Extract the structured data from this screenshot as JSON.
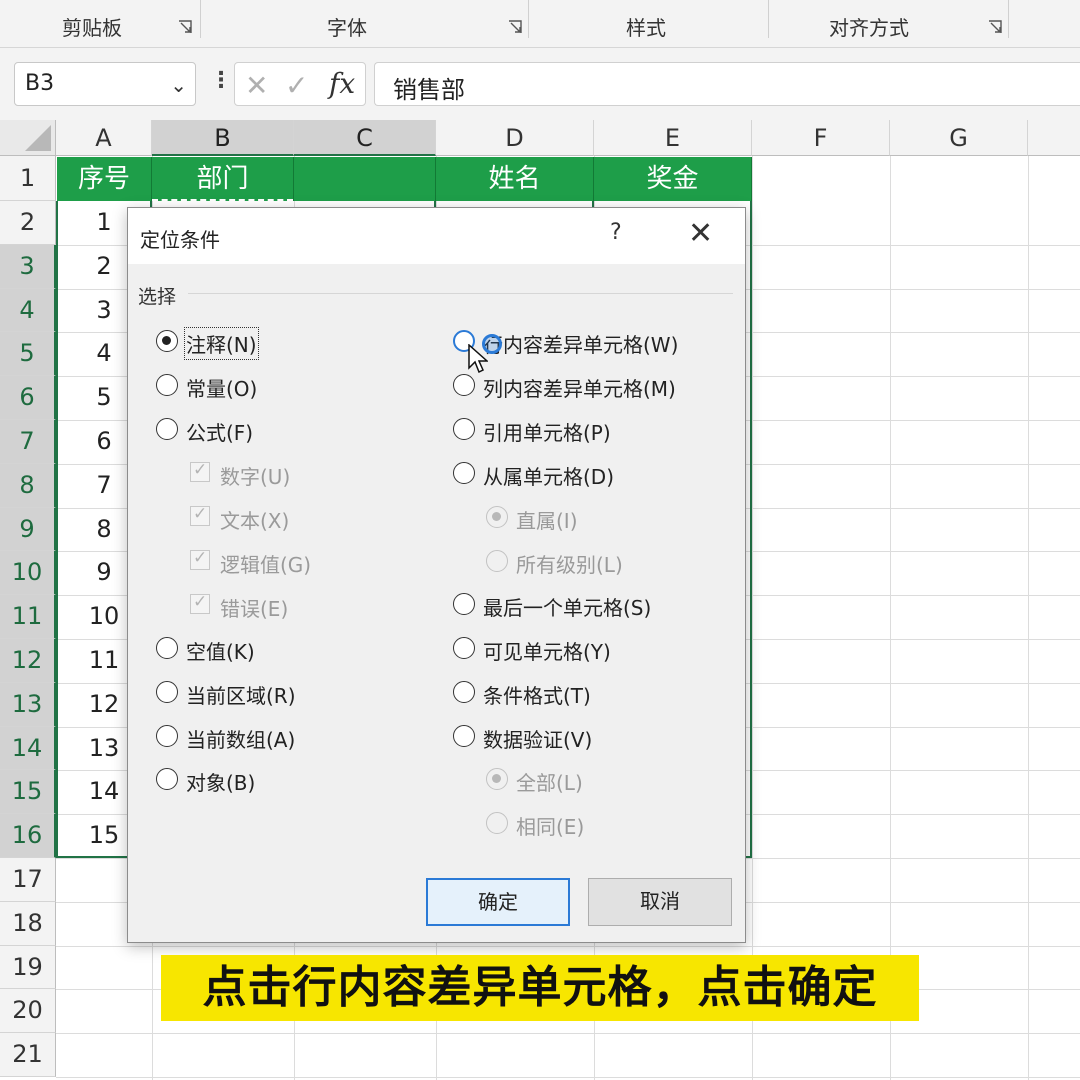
{
  "ribbon": {
    "groups": [
      "剪贴板",
      "字体",
      "样式",
      "对齐方式"
    ]
  },
  "formula_bar": {
    "name_box": "B3",
    "fx_label": "fx",
    "value": "销售部"
  },
  "sheet": {
    "columns": [
      "A",
      "B",
      "C",
      "D",
      "E",
      "F",
      "G"
    ],
    "selected_columns": [
      "B",
      "C"
    ],
    "rows": [
      "1",
      "2",
      "3",
      "4",
      "5",
      "6",
      "7",
      "8",
      "9",
      "10",
      "11",
      "12",
      "13",
      "14",
      "15",
      "16",
      "17",
      "18",
      "19",
      "20",
      "21"
    ],
    "header_row": {
      "A": "序号",
      "B": "部门",
      "C": "",
      "D": "姓名",
      "E": "奖金"
    },
    "serial_numbers": [
      "1",
      "2",
      "3",
      "4",
      "5",
      "6",
      "7",
      "8",
      "9",
      "10",
      "11",
      "12",
      "13",
      "14",
      "15"
    ],
    "header_color": "#1e9e49"
  },
  "dialog": {
    "title": "定位条件",
    "help": "?",
    "close": "✕",
    "section_label": "选择",
    "left_options": [
      {
        "label": "注释(N)",
        "checked": true
      },
      {
        "label": "常量(O)",
        "checked": false
      },
      {
        "label": "公式(F)",
        "checked": false
      }
    ],
    "formula_sub": [
      "数字(U)",
      "文本(X)",
      "逻辑值(G)",
      "错误(E)"
    ],
    "left_options_2": [
      {
        "label": "空值(K)"
      },
      {
        "label": "当前区域(R)"
      },
      {
        "label": "当前数组(A)"
      },
      {
        "label": "对象(B)"
      }
    ],
    "right_options": [
      {
        "label": "行内容差异单元格(W)"
      },
      {
        "label": "列内容差异单元格(M)"
      },
      {
        "label": "引用单元格(P)"
      },
      {
        "label": "从属单元格(D)"
      }
    ],
    "dependents_sub": [
      {
        "label": "直属(I)",
        "checked": true
      },
      {
        "label": "所有级别(L)",
        "checked": false
      }
    ],
    "right_options_2": [
      {
        "label": "最后一个单元格(S)"
      },
      {
        "label": "可见单元格(Y)"
      },
      {
        "label": "条件格式(T)"
      },
      {
        "label": "数据验证(V)"
      }
    ],
    "validation_sub": [
      {
        "label": "全部(L)",
        "checked": true
      },
      {
        "label": "相同(E)",
        "checked": false
      }
    ],
    "ok": "确定",
    "cancel": "取消"
  },
  "caption": "点击行内容差异单元格，点击确定",
  "colors": {
    "accent": "#217346",
    "focus": "#2b7ad6",
    "caption_bg": "#f7e600"
  }
}
